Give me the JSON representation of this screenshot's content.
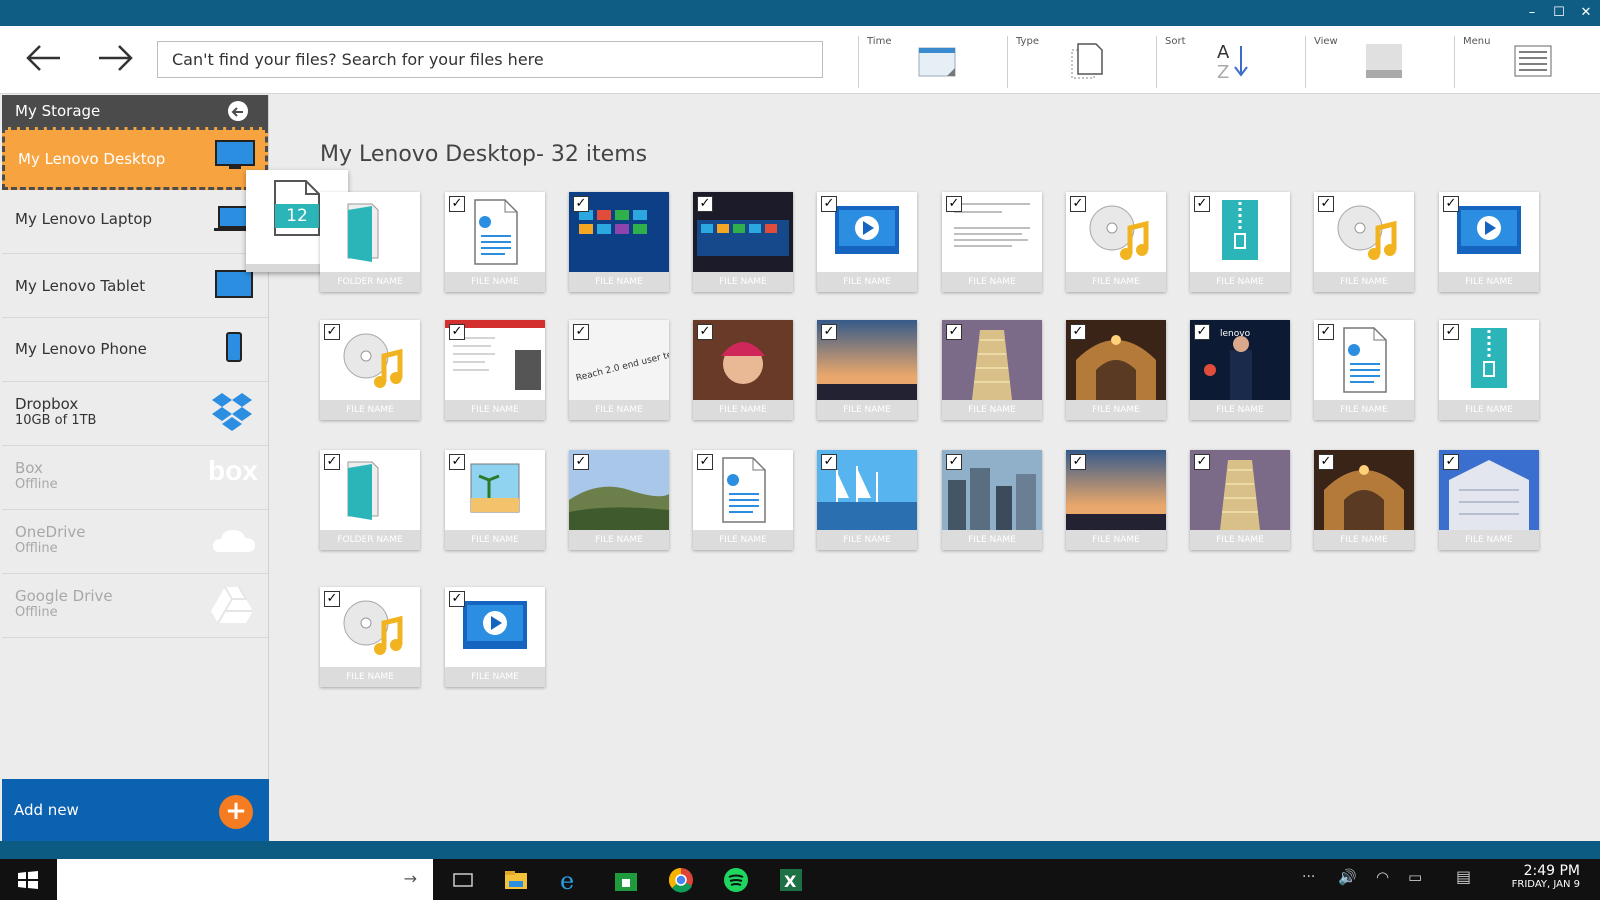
{
  "toolbar": {
    "search_placeholder": "Can't find your files? Search for your files here",
    "time_label": "Time",
    "type_label": "Type",
    "sort_label": "Sort",
    "view_label": "View",
    "menu_label": "Menu"
  },
  "sidebar": {
    "header": "My Storage",
    "items": [
      {
        "name": "My Lenovo Desktop",
        "sub": ""
      },
      {
        "name": "My Lenovo Laptop",
        "sub": ""
      },
      {
        "name": "My Lenovo Tablet",
        "sub": ""
      },
      {
        "name": "My Lenovo Phone",
        "sub": ""
      },
      {
        "name": "Dropbox",
        "sub": "10GB of 1TB"
      },
      {
        "name": "Box",
        "sub": "Offline"
      },
      {
        "name": "OneDrive",
        "sub": "Offline"
      },
      {
        "name": "Google Drive",
        "sub": "Offline"
      }
    ],
    "add_new": "Add new",
    "box_logo": "box"
  },
  "drag_count": "12",
  "main": {
    "title": "My Lenovo Desktop- 32 items",
    "tiles": [
      {
        "kind": "folder",
        "caption": "FOLDER NAME",
        "checked": false
      },
      {
        "kind": "doc",
        "caption": "FILE NAME",
        "checked": true
      },
      {
        "kind": "photo-tiles",
        "caption": "FILE NAME",
        "checked": true
      },
      {
        "kind": "photo-tiles-dark",
        "caption": "FILE NAME",
        "checked": true
      },
      {
        "kind": "video",
        "caption": "FILE NAME",
        "checked": true
      },
      {
        "kind": "text-doc",
        "caption": "FILE NAME",
        "checked": true
      },
      {
        "kind": "audio",
        "caption": "FILE NAME",
        "checked": true
      },
      {
        "kind": "zip",
        "caption": "FILE NAME",
        "checked": true
      },
      {
        "kind": "audio",
        "caption": "FILE NAME",
        "checked": true
      },
      {
        "kind": "video",
        "caption": "FILE NAME",
        "checked": true
      },
      {
        "kind": "audio",
        "caption": "FILE NAME",
        "checked": true
      },
      {
        "kind": "slides",
        "caption": "FILE NAME",
        "checked": true
      },
      {
        "kind": "paper",
        "caption": "FILE NAME",
        "checked": true
      },
      {
        "kind": "child",
        "caption": "FILE NAME",
        "checked": true
      },
      {
        "kind": "sunset",
        "caption": "FILE NAME",
        "checked": true
      },
      {
        "kind": "tower",
        "caption": "FILE NAME",
        "checked": true
      },
      {
        "kind": "arch",
        "caption": "FILE NAME",
        "checked": true
      },
      {
        "kind": "stage",
        "caption": "FILE NAME",
        "checked": true
      },
      {
        "kind": "doc",
        "caption": "FILE NAME",
        "checked": true
      },
      {
        "kind": "zip",
        "caption": "FILE NAME",
        "checked": true
      },
      {
        "kind": "folder",
        "caption": "FOLDER NAME",
        "checked": true
      },
      {
        "kind": "image",
        "caption": "FILE NAME",
        "checked": true
      },
      {
        "kind": "hills",
        "caption": "FILE NAME",
        "checked": true
      },
      {
        "kind": "doc",
        "caption": "FILE NAME",
        "checked": true
      },
      {
        "kind": "harbor",
        "caption": "FILE NAME",
        "checked": true
      },
      {
        "kind": "city",
        "caption": "FILE NAME",
        "checked": true
      },
      {
        "kind": "sunset",
        "caption": "FILE NAME",
        "checked": true
      },
      {
        "kind": "tower",
        "caption": "FILE NAME",
        "checked": true
      },
      {
        "kind": "arch",
        "caption": "FILE NAME",
        "checked": true
      },
      {
        "kind": "building",
        "caption": "FILE NAME",
        "checked": true
      },
      {
        "kind": "audio",
        "caption": "FILE NAME",
        "checked": true
      },
      {
        "kind": "video",
        "caption": "FILE NAME",
        "checked": true
      }
    ]
  },
  "taskbar": {
    "time": "2:49 PM",
    "date": "FRIDAY, JAN 9"
  },
  "colors": {
    "accent": "#0f5d84",
    "active_item": "#f7a440",
    "add_new": "#0a62b1",
    "teal_icon": "#2bb5b8",
    "orange_plus": "#f57c20"
  }
}
